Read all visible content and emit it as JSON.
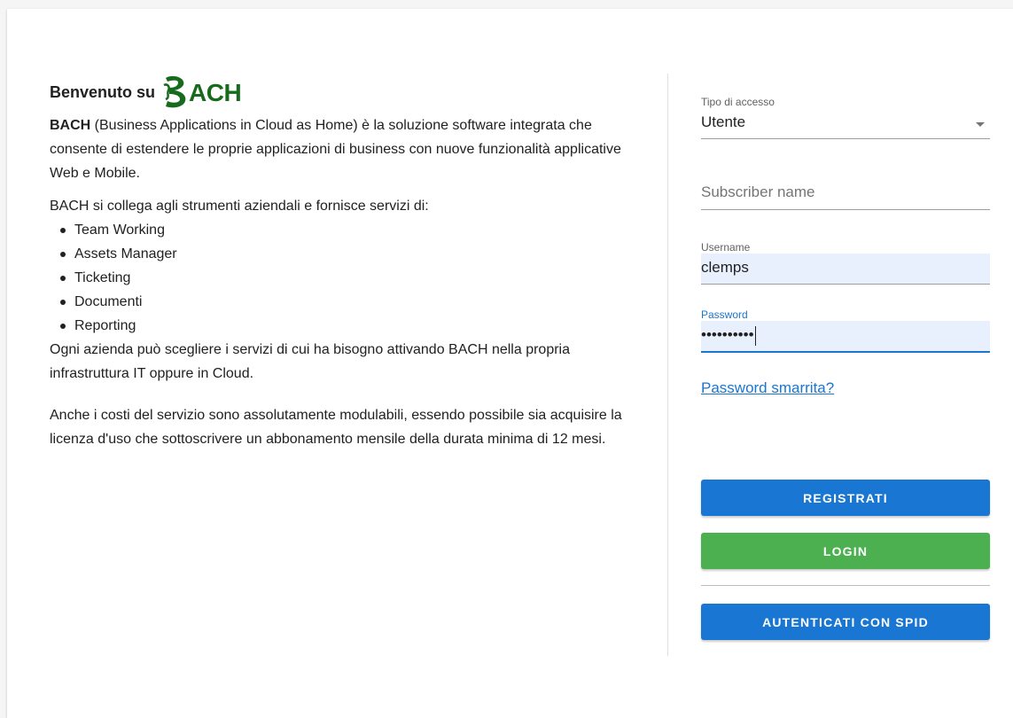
{
  "welcome": {
    "prefix": "Benvenuto su",
    "logo_text": "ACH",
    "logo_color": "#176b1c"
  },
  "intro": {
    "brand": "BACH",
    "rest": " (Business Applications in Cloud as Home) è la soluzione software integrata che consente di estendere le proprie applicazioni di business con nuove funzionalità applicative Web e Mobile."
  },
  "services": {
    "lead": "BACH si collega agli strumenti aziendali e fornisce servizi di:",
    "items": [
      "Team Working",
      "Assets Manager",
      "Ticketing",
      "Documenti",
      "Reporting"
    ]
  },
  "paragraphs": {
    "choice": "Ogni azienda può scegliere i servizi di cui ha bisogno attivando BACH nella propria infrastruttura IT oppure in Cloud.",
    "costs": "Anche i costi del servizio sono assolutamente modulabili, essendo possibile sia acquisire la licenza d'uso che sottoscrivere un abbonamento mensile della durata minima di 12 mesi."
  },
  "form": {
    "access_type": {
      "label": "Tipo di accesso",
      "value": "Utente",
      "icon": "chevron-down-icon"
    },
    "subscriber": {
      "placeholder": "Subscriber name",
      "value": ""
    },
    "username": {
      "label": "Username",
      "value": "clemps"
    },
    "password": {
      "label": "Password",
      "masked_value": "••••••••••"
    },
    "forgot_link": "Password smarrita?"
  },
  "buttons": {
    "register": "REGISTRATI",
    "login": "LOGIN",
    "spid": "AUTENTICATI CON SPID"
  },
  "colors": {
    "primary": "#1976d2",
    "success": "#4caf50",
    "autofill": "#e8f0fe"
  }
}
